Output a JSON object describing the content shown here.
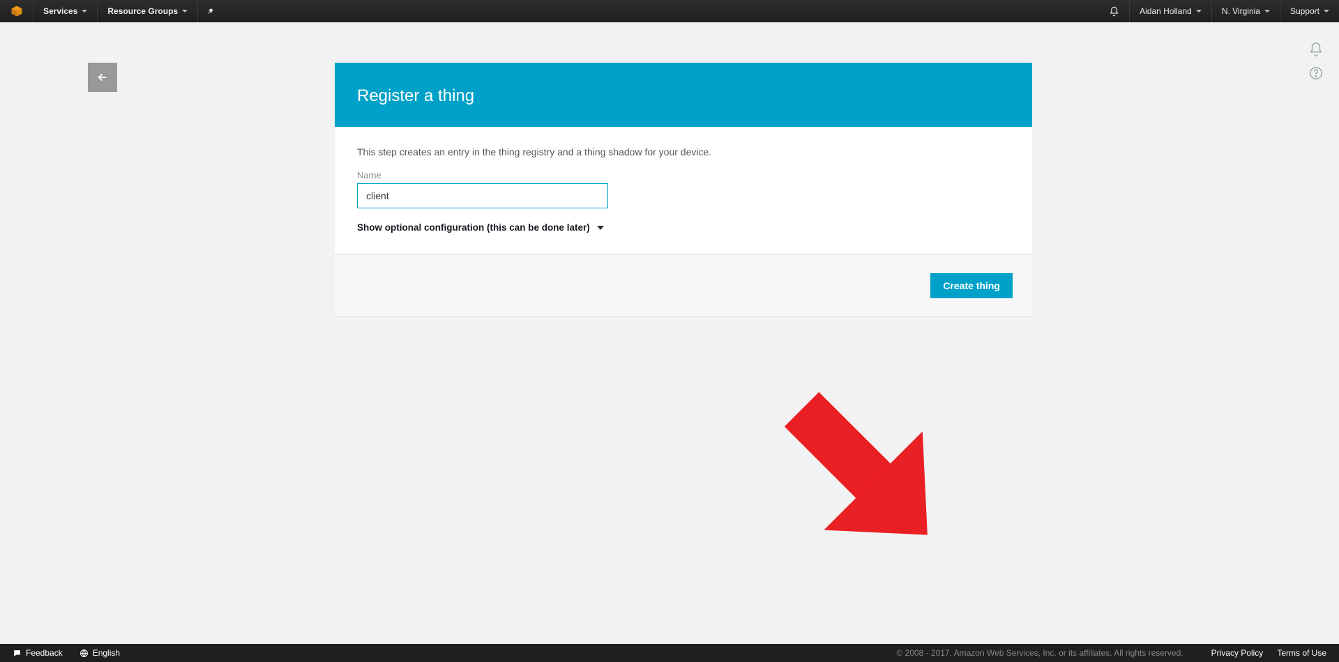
{
  "topnav": {
    "services": "Services",
    "resource_groups": "Resource Groups",
    "account_name": "Aidan Holland",
    "region": "N. Virginia",
    "support": "Support"
  },
  "page": {
    "header_title": "Register a thing",
    "description": "This step creates an entry in the thing registry and a thing shadow for your device.",
    "name_label": "Name",
    "name_value": "client",
    "optional_toggle": "Show optional configuration (this can be done later)",
    "create_button": "Create thing"
  },
  "footer": {
    "feedback": "Feedback",
    "language": "English",
    "copyright": "© 2008 - 2017, Amazon Web Services, Inc. or its affiliates. All rights reserved.",
    "privacy": "Privacy Policy",
    "terms": "Terms of Use"
  }
}
